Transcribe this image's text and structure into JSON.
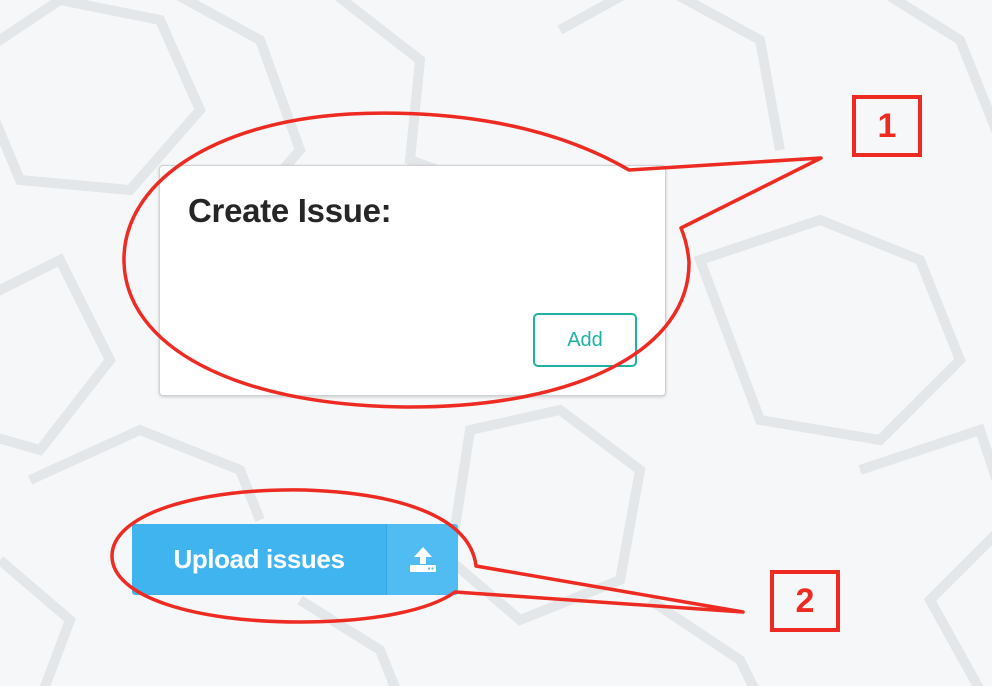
{
  "create_issue": {
    "title": "Create Issue:",
    "add_label": "Add"
  },
  "upload": {
    "label": "Upload issues",
    "icon": "upload-icon"
  },
  "callouts": [
    "1",
    "2"
  ],
  "colors": {
    "background": "#f6f7f8",
    "add_accent": "#1fb2a3",
    "upload_blue": "#3fb4ee",
    "annotation_red": "#ee2b22"
  }
}
